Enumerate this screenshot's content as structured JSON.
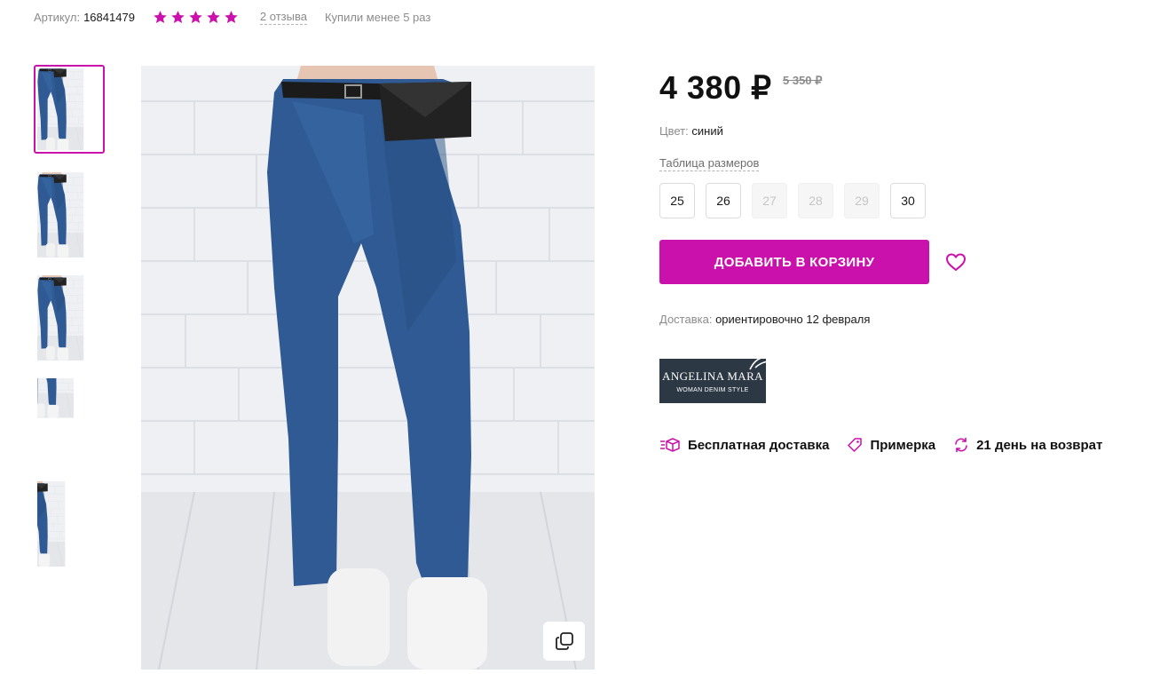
{
  "meta": {
    "article_label": "Артикул:",
    "article_value": "16841479",
    "rating": 5,
    "reviews_label": "2 отзыва",
    "bought_label": "Купили менее 5 раз"
  },
  "thumbnails": [
    {
      "name": "photo-1",
      "active": true
    },
    {
      "name": "photo-2",
      "active": false
    },
    {
      "name": "photo-3",
      "active": false
    },
    {
      "name": "photo-4",
      "active": false
    },
    {
      "name": "photo-5",
      "active": false
    }
  ],
  "product": {
    "price": "4 380 ₽",
    "old_price": "5 350 ₽",
    "color_label": "Цвет:",
    "color_value": "синий",
    "size_table_label": "Таблица размеров",
    "sizes": [
      {
        "label": "25",
        "available": true
      },
      {
        "label": "26",
        "available": true
      },
      {
        "label": "27",
        "available": false
      },
      {
        "label": "28",
        "available": false
      },
      {
        "label": "29",
        "available": false
      },
      {
        "label": "30",
        "available": true
      }
    ],
    "add_to_cart_label": "ДОБАВИТЬ В КОРЗИНУ",
    "delivery_label": "Доставка:",
    "delivery_value": "ориентировочно 12 февраля"
  },
  "brand": {
    "name": "ANGELINA MARA",
    "tagline": "WOMAN DENIM STYLE"
  },
  "features": [
    {
      "label": "Бесплатная доставка",
      "icon": "delivery-box-icon"
    },
    {
      "label": "Примерка",
      "icon": "tag-icon"
    },
    {
      "label": "21 день на возврат",
      "icon": "return-arrows-icon"
    }
  ],
  "colors": {
    "accent": "#cb11ab",
    "text": "#1a1a1a",
    "muted": "#8b8b8b",
    "denim": "#2f5a93",
    "brand_bg": "#2d3845"
  }
}
